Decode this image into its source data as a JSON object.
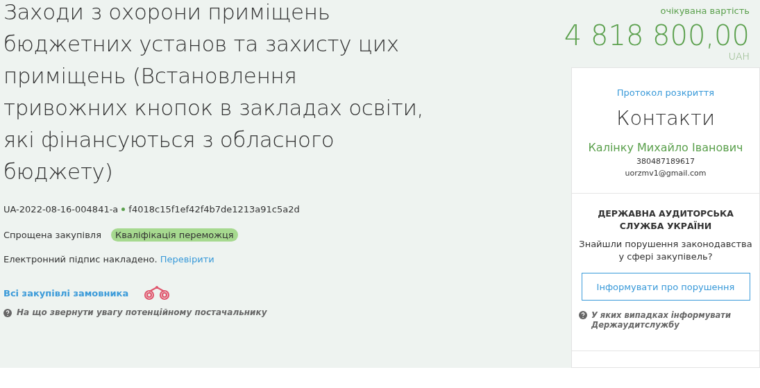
{
  "title_lines": [
    "Заходи з охорони приміщень",
    "бюджетних установ та захисту цих",
    "приміщень (Встановлення",
    "тривожних кнопок в закладах освіти,",
    "які фінансуються з обласного",
    "бюджету)"
  ],
  "tender_id": "UA-2022-08-16-004841-a",
  "hash": "f4018c15f1ef42f4b7de1213a91c5a2d",
  "procedure": "Спрощена закупівля",
  "status": {
    "label": "Кваліфікація переможця",
    "color": "#a6d98f"
  },
  "signature": {
    "text": "Електронний підпис накладено.",
    "link": "Перевірити"
  },
  "all_purchases_link": "Всі закупівлі замовника",
  "hint": "На що звернути увагу потенційному постачальнику",
  "value": {
    "label": "очікувана вартість",
    "amount": "4 818 800,00",
    "currency": "UAH"
  },
  "sidebar": {
    "protocol_link": "Протокол розкриття",
    "contacts_title": "Контакти",
    "contact_name": "Калінку Михайло Іванович",
    "phone": "380487189617",
    "email": "uorzmv1@gmail.com",
    "audit_title": "ДЕРЖАВНА АУДИТОРСЬКА СЛУЖБА УКРАЇНИ",
    "audit_question": "Знайшли порушення законодавства у сфері закупівель?",
    "report_button": "Інформувати про порушення",
    "audit_hint": "У яких випадках інформувати Держаудитслужбу"
  }
}
